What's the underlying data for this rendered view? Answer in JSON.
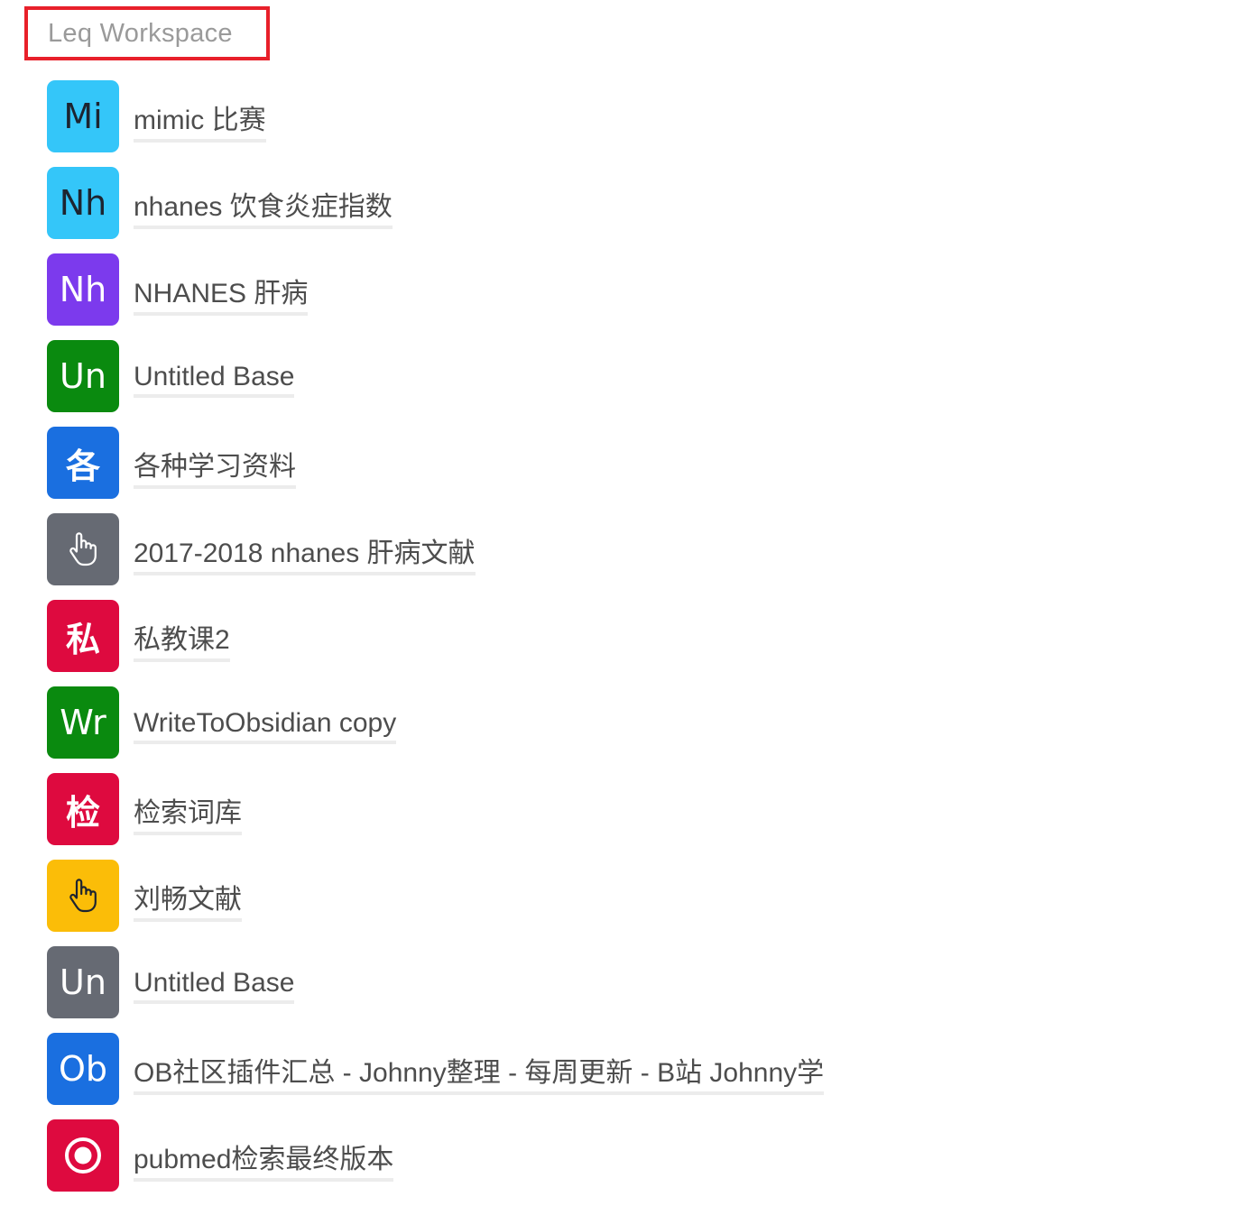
{
  "workspace": {
    "title": "Leq Workspace"
  },
  "bases": [
    {
      "name": "mimic 比赛",
      "icon_text": "Mi",
      "icon_color": "#34c6f9",
      "icon_text_color": "#1d2430"
    },
    {
      "name": "nhanes 饮食炎症指数",
      "icon_text": "Nh",
      "icon_color": "#34c6f9",
      "icon_text_color": "#1d2430"
    },
    {
      "name": "NHANES 肝病",
      "icon_text": "Nh",
      "icon_color": "#7c3aed",
      "icon_text_color": "#ffffff"
    },
    {
      "name": "Untitled Base",
      "icon_text": "Un",
      "icon_color": "#0a8a0f",
      "icon_text_color": "#ffffff"
    },
    {
      "name": "各种学习资料",
      "icon_text": "各",
      "icon_color": "#1a6fe0",
      "icon_text_color": "#ffffff"
    },
    {
      "name": "2017-2018 nhanes 肝病文献",
      "icon": "hand-pointer-icon",
      "icon_color": "#666a73",
      "icon_text_color": "#ffffff"
    },
    {
      "name": "私教课2",
      "icon_text": "私",
      "icon_color": "#de0a3f",
      "icon_text_color": "#ffffff"
    },
    {
      "name": "WriteToObsidian copy",
      "icon_text": "Wr",
      "icon_color": "#0a8a0f",
      "icon_text_color": "#ffffff"
    },
    {
      "name": "检索词库",
      "icon_text": "检",
      "icon_color": "#de0a3f",
      "icon_text_color": "#ffffff"
    },
    {
      "name": "刘畅文献",
      "icon": "hand-pointer-icon",
      "icon_color": "#fbbd08",
      "icon_text_color": "#1d2430"
    },
    {
      "name": "Untitled Base",
      "icon_text": "Un",
      "icon_color": "#666a73",
      "icon_text_color": "#ffffff"
    },
    {
      "name": "OB社区插件汇总 - Johnny整理 - 每周更新 - B站 Johnny学",
      "icon_text": "Ob",
      "icon_color": "#1a6fe0",
      "icon_text_color": "#ffffff"
    },
    {
      "name": "pubmed检索最终版本",
      "icon": "target-icon",
      "icon_color": "#de0a3f",
      "icon_text_color": "#ffffff"
    }
  ]
}
